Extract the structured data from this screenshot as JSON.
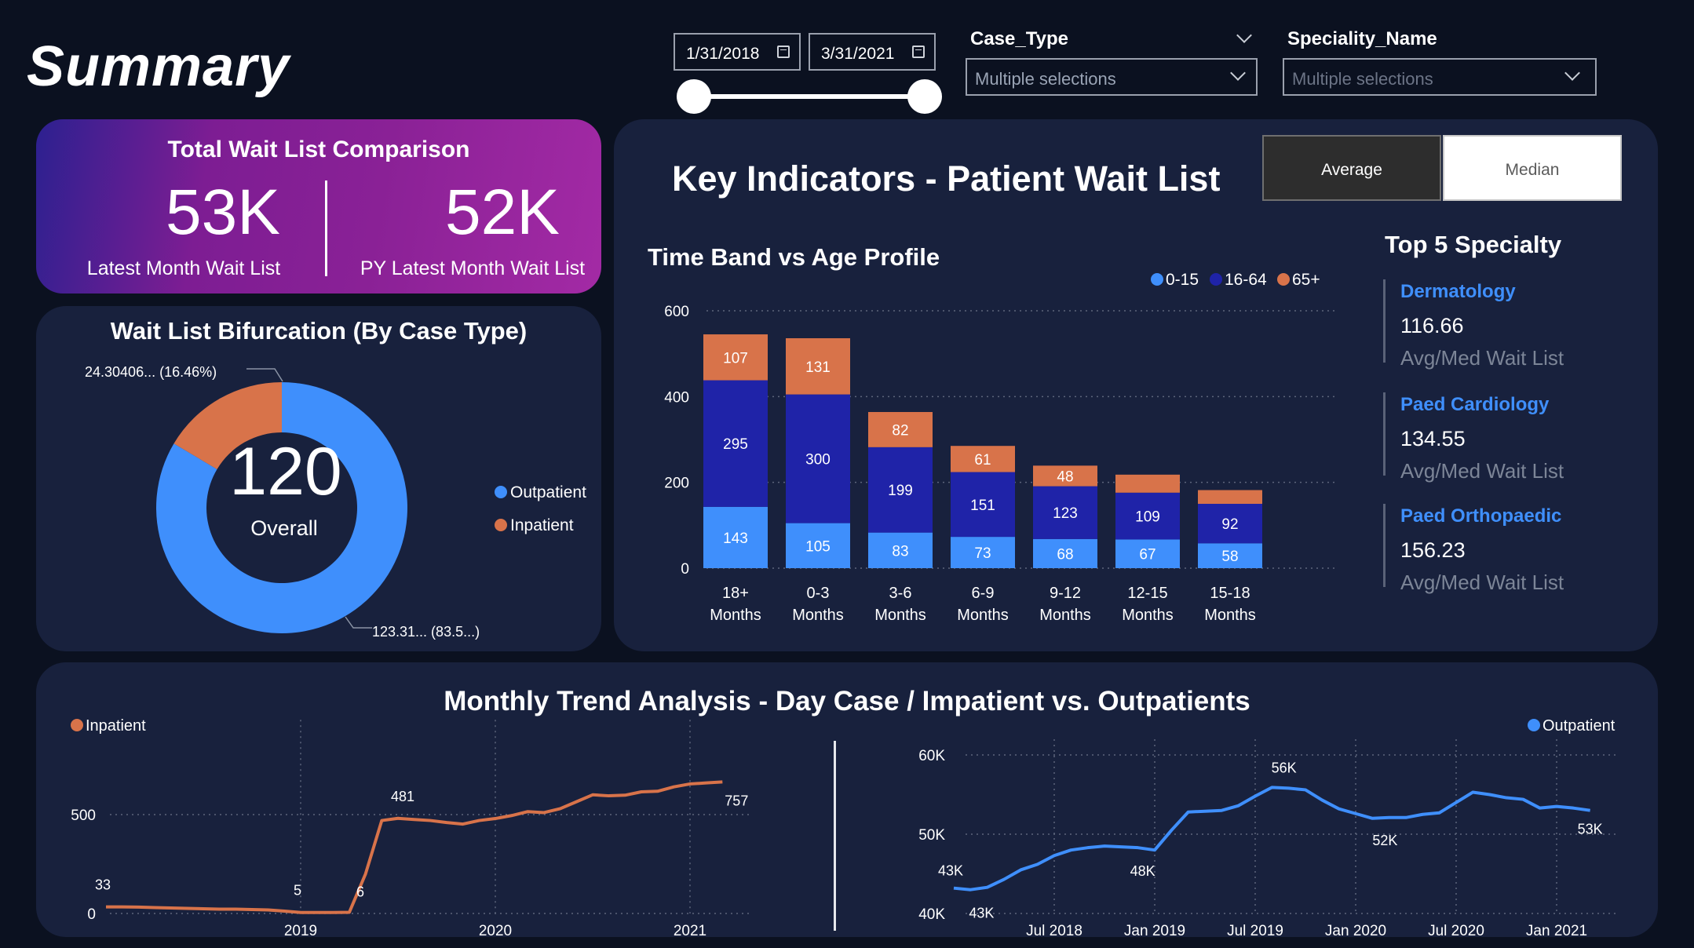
{
  "page": {
    "title": "Summary"
  },
  "date_range": {
    "start": "1/31/2018",
    "end": "3/31/2021"
  },
  "filters": {
    "case_type": {
      "label": "Case_Type",
      "value": "Multiple selections"
    },
    "speciality": {
      "label": "Speciality_Name",
      "value": "Multiple selections"
    }
  },
  "kpi": {
    "title": "Total Wait List Comparison",
    "latest_value": "53K",
    "latest_label": "Latest Month Wait List",
    "py_value": "52K",
    "py_label": "PY Latest Month Wait List"
  },
  "donut": {
    "title": "Wait List Bifurcation (By Case Type)",
    "center_value": "120",
    "center_label": "Overall",
    "label_inpatient": "24.30406... (16.46%)",
    "label_outpatient": "123.31... (83.5...)",
    "legend": [
      "Outpatient",
      "Inpatient"
    ]
  },
  "key_indicators": {
    "title": "Key Indicators - Patient Wait List",
    "toggle_average": "Average",
    "toggle_median": "Median",
    "chart_title": "Time Band vs Age Profile"
  },
  "top5": {
    "title": "Top 5 Specialty",
    "items": [
      {
        "name": "Dermatology",
        "value": "116.66",
        "label": "Avg/Med Wait List"
      },
      {
        "name": "Paed Cardiology",
        "value": "134.55",
        "label": "Avg/Med Wait List"
      },
      {
        "name": "Paed Orthopaedic",
        "value": "156.23",
        "label": "Avg/Med Wait List"
      }
    ]
  },
  "trend": {
    "title": "Monthly Trend Analysis - Day Case / Impatient vs. Outpatients"
  },
  "colors": {
    "blue_light": "#3f8ffc",
    "blue_dark": "#1f23a8",
    "orange": "#d8734a",
    "panel": "#18213d",
    "background": "#0b1120"
  },
  "chart_data": [
    {
      "type": "pie",
      "variant": "donut",
      "categories": [
        "Outpatient",
        "Inpatient"
      ],
      "values": [
        123.31,
        24.30406
      ],
      "percent": [
        83.54,
        16.46
      ],
      "legend_position": "right"
    },
    {
      "type": "bar",
      "stacked": true,
      "title": "Time Band vs Age Profile",
      "categories": [
        "18+\nMonths",
        "0-3\nMonths",
        "3-6\nMonths",
        "6-9\nMonths",
        "9-12\nMonths",
        "12-15\nMonths",
        "15-18\nMonths"
      ],
      "series": [
        {
          "name": "0-15",
          "color": "#3f8ffc",
          "values": [
            143,
            105,
            83,
            73,
            68,
            67,
            58
          ]
        },
        {
          "name": "16-64",
          "color": "#1f23a8",
          "values": [
            295,
            300,
            199,
            151,
            123,
            109,
            92
          ]
        },
        {
          "name": "65+",
          "color": "#d8734a",
          "values": [
            107,
            131,
            82,
            61,
            48,
            42,
            32
          ]
        }
      ],
      "value_labels_shown": [
        [
          true,
          true,
          true,
          true,
          true,
          true,
          true
        ],
        [
          true,
          true,
          true,
          true,
          true,
          true,
          true
        ],
        [
          true,
          true,
          true,
          true,
          true,
          false,
          false
        ]
      ],
      "yticks": [
        0,
        200,
        400,
        600
      ],
      "ylim": [
        0,
        600
      ],
      "grid": true,
      "legend_position": "top-right"
    },
    {
      "type": "line",
      "series": [
        {
          "name": "Inpatient",
          "color": "#d8734a",
          "x": [
            "2018-01",
            "2018-02",
            "2018-03",
            "2018-04",
            "2018-05",
            "2018-06",
            "2018-07",
            "2018-08",
            "2018-09",
            "2018-10",
            "2018-11",
            "2018-12",
            "2019-01",
            "2019-02",
            "2019-03",
            "2019-04",
            "2019-05",
            "2019-06",
            "2019-07",
            "2019-08",
            "2019-09",
            "2019-10",
            "2019-11",
            "2019-12",
            "2020-01",
            "2020-02",
            "2020-03",
            "2020-04",
            "2020-05",
            "2020-06",
            "2020-07",
            "2020-08",
            "2020-09",
            "2020-10",
            "2020-11",
            "2020-12",
            "2021-01",
            "2021-02",
            "2021-03"
          ],
          "values": [
            33,
            33,
            32,
            30,
            28,
            26,
            24,
            22,
            22,
            20,
            18,
            12,
            5,
            5,
            5,
            6,
            200,
            470,
            481,
            475,
            470,
            460,
            452,
            470,
            480,
            495,
            515,
            510,
            530,
            565,
            600,
            595,
            598,
            615,
            618,
            640,
            655,
            660,
            665
          ],
          "point_labels": [
            {
              "x": "2018-01",
              "label": "33"
            },
            {
              "x": "2019-01",
              "label": "5"
            },
            {
              "x": "2019-04",
              "label": "6"
            },
            {
              "x": "2019-07",
              "label": "481"
            },
            {
              "x": "2021-03",
              "label": "757"
            }
          ]
        }
      ],
      "xticks": [
        "2019",
        "2020",
        "2021"
      ],
      "yticks": [
        0,
        500
      ],
      "ylim": [
        0,
        900
      ],
      "grid": true,
      "legend_position": "top-left"
    },
    {
      "type": "line",
      "series": [
        {
          "name": "Outpatient",
          "color": "#3f8ffc",
          "x": [
            "2018-01",
            "2018-02",
            "2018-03",
            "2018-04",
            "2018-05",
            "2018-06",
            "2018-07",
            "2018-08",
            "2018-09",
            "2018-10",
            "2018-11",
            "2018-12",
            "2019-01",
            "2019-02",
            "2019-03",
            "2019-04",
            "2019-05",
            "2019-06",
            "2019-07",
            "2019-08",
            "2019-09",
            "2019-10",
            "2019-11",
            "2019-12",
            "2020-01",
            "2020-02",
            "2020-03",
            "2020-04",
            "2020-05",
            "2020-06",
            "2020-07",
            "2020-08",
            "2020-09",
            "2020-10",
            "2020-11",
            "2020-12",
            "2021-01",
            "2021-02",
            "2021-03"
          ],
          "values": [
            43200,
            43000,
            43300,
            44300,
            45500,
            46200,
            47300,
            48000,
            48300,
            48500,
            48400,
            48300,
            48000,
            50500,
            52800,
            52900,
            53000,
            53600,
            54800,
            55900,
            55800,
            55600,
            54300,
            53200,
            52600,
            52000,
            52100,
            52100,
            52500,
            52700,
            54000,
            55300,
            55000,
            54600,
            54400,
            53300,
            53500,
            53300,
            53000
          ],
          "point_labels": [
            {
              "x": "2018-01",
              "label": "43K"
            },
            {
              "x": "2018-02",
              "label": "43K"
            },
            {
              "x": "2018-12",
              "label": "48K"
            },
            {
              "x": "2019-09",
              "label": "56K"
            },
            {
              "x": "2020-02",
              "label": "52K"
            },
            {
              "x": "2021-03",
              "label": "53K"
            }
          ]
        }
      ],
      "xticks": [
        "Jul 2018",
        "Jan 2019",
        "Jul 2019",
        "Jan 2020",
        "Jul 2020",
        "Jan 2021"
      ],
      "yticks": [
        40000,
        50000,
        60000
      ],
      "ytick_labels": [
        "40K",
        "50K",
        "60K"
      ],
      "ylim": [
        40000,
        60000
      ],
      "grid": true,
      "legend_position": "top-right"
    }
  ]
}
